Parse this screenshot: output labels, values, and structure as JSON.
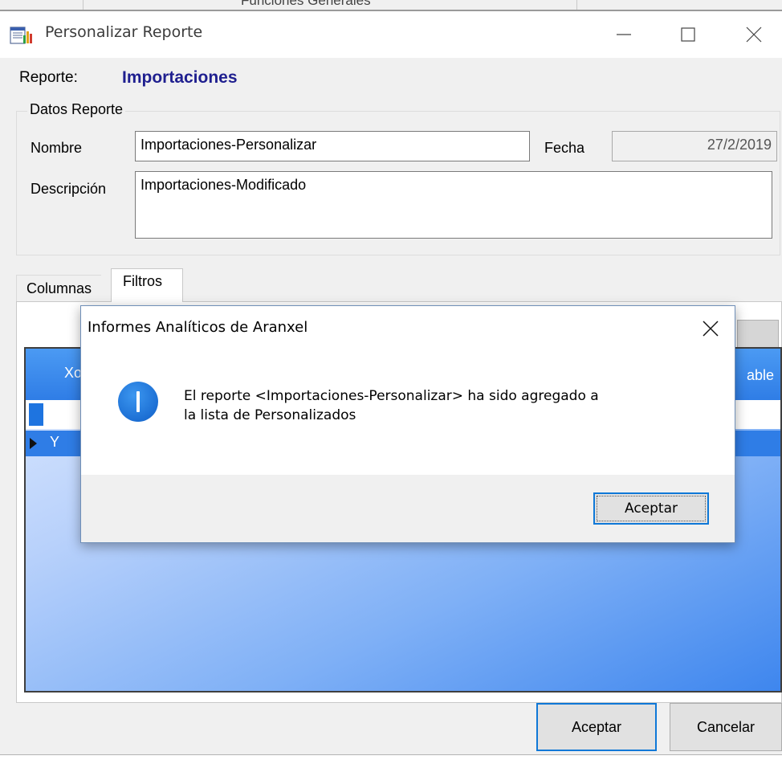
{
  "underlying_window": {
    "clipped_text": "Funciones Generales"
  },
  "main_window": {
    "title": "Personalizar Reporte",
    "report_caption": "Reporte:",
    "report_name": "Importaciones",
    "group_title": "Datos Reporte",
    "nombre_label": "Nombre",
    "nombre_value": "Importaciones-Personalizar",
    "fecha_label": "Fecha",
    "fecha_value": "27/2/2019",
    "descripcion_label": "Descripción",
    "descripcion_value": "Importaciones-Modificado",
    "tabs": [
      {
        "label": "Columnas",
        "active": false
      },
      {
        "label": "Filtros",
        "active": true
      }
    ],
    "grid": {
      "columns": [
        "Xor",
        "able"
      ],
      "rows": [
        {
          "value": "Y"
        }
      ],
      "header_color": "#2f7de6"
    },
    "buttons": {
      "ok": "Aceptar",
      "cancel": "Cancelar"
    }
  },
  "dialog": {
    "title": "Informes Analíticos de Aranxel",
    "icon": "info-icon",
    "message": "El reporte <Importaciones-Personalizar> ha sido agregado a\nla lista de Personalizados",
    "ok_label": "Aceptar",
    "accent_color": "#0f78d7"
  }
}
